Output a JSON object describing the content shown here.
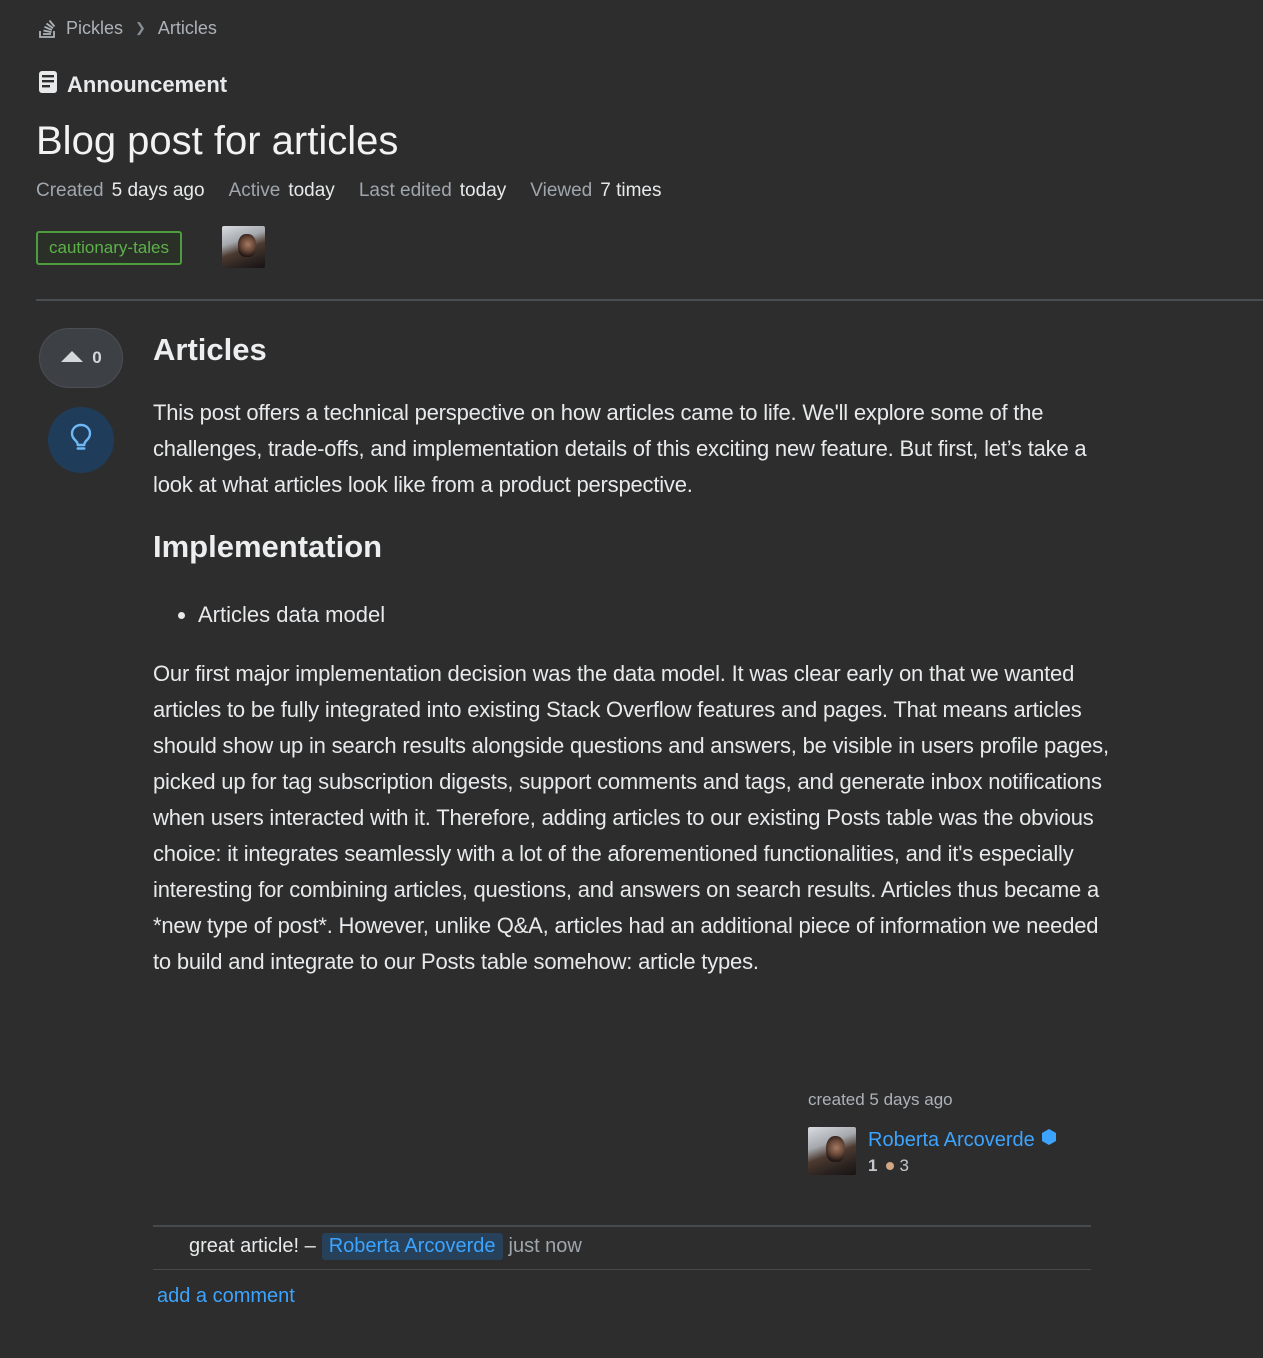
{
  "breadcrumb": {
    "items": [
      "Pickles",
      "Articles"
    ]
  },
  "article_type": "Announcement",
  "title": "Blog post for articles",
  "meta": {
    "created_label": "Created",
    "created_value": "5 days ago",
    "active_label": "Active",
    "active_value": "today",
    "edited_label": "Last edited",
    "edited_value": "today",
    "viewed_label": "Viewed",
    "viewed_value": "7 times"
  },
  "tags": [
    "cautionary-tales"
  ],
  "votes": {
    "score": "0"
  },
  "body": {
    "heading_1": "Articles",
    "intro": "This post offers a technical perspective on how articles came to life. We'll explore some of the challenges, trade-offs, and implementation details of this exciting new feature. But first, let’s take a look at what articles look like from a product perspective.",
    "heading_2": "Implementation",
    "bullets": [
      "Articles data model"
    ],
    "paragraph": "Our first major implementation decision was the data model. It was clear early on that we wanted articles to be fully integrated into existing Stack Overflow features and pages. That means articles should show up in search results alongside questions and answers, be visible in users profile pages, picked up for tag subscription digests, support comments and tags, and generate inbox notifications when users interacted with it. Therefore, adding articles to our existing Posts table was the obvious choice: it integrates seamlessly with a lot of the aforementioned functionalities, and it's especially interesting for combining articles, questions, and answers on search results. Articles thus became a *new type of post*. However, unlike Q&A, articles had an additional piece of information we needed to build and integrate to our Posts table somehow: article types."
  },
  "signature": {
    "action": "created 5 days ago",
    "user_name": "Roberta Arcoverde",
    "reputation": "1",
    "bronze_badges": "3"
  },
  "comments": [
    {
      "text": "great article! –",
      "user": "Roberta Arcoverde",
      "time": "just now"
    }
  ],
  "add_comment_label": "add a comment",
  "colors": {
    "background": "#2d2d2d",
    "link": "#3ca4ff",
    "tag_border": "#4d9d3f",
    "tag_text": "#5db14b",
    "bulb_bg": "#1f3d5a",
    "bronze": "#d1a684"
  },
  "icons": {
    "site_logo": "stack-pickles-icon",
    "breadcrumb_separator": "chevron-right-icon",
    "article_type": "document-icon",
    "upvote": "caret-up-icon",
    "bulb": "lightbulb-icon",
    "moderator": "diamond-badge-icon"
  }
}
